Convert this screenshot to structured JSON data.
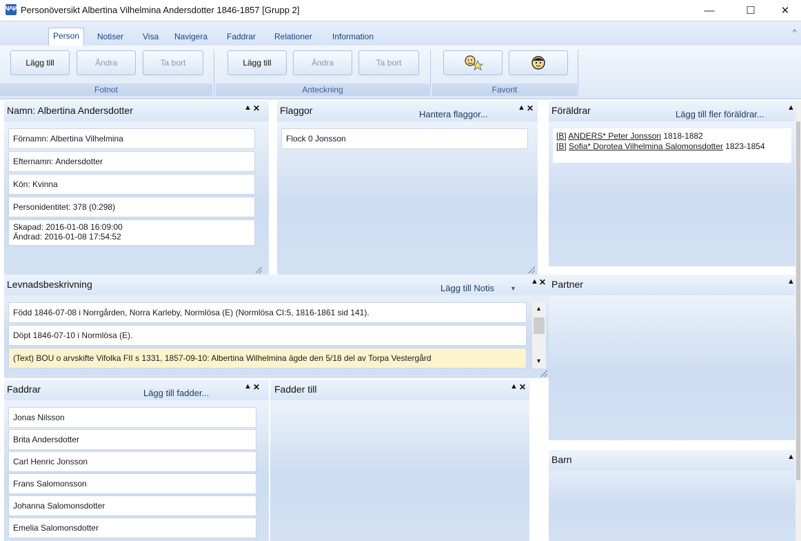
{
  "window": {
    "title": "Personöversikt Albertina Vilhelmina Andersdotter 1846-1857 [Grupp 2]",
    "app_icon": "app-tree-icon",
    "minimize": "—",
    "maximize": "☐",
    "close": "✕"
  },
  "ribbon": {
    "tabs": [
      "Person",
      "Notiser",
      "Visa",
      "Navigera",
      "Faddrar",
      "Relationer",
      "Information"
    ],
    "active_tab": "Person",
    "groups": [
      {
        "label": "Fotnot",
        "buttons": [
          "Lägg till",
          "Ändra",
          "Ta bort"
        ]
      },
      {
        "label": "Anteckning",
        "buttons": [
          "Lägg till",
          "Ändra",
          "Ta bort"
        ]
      },
      {
        "label": "Favorit",
        "buttons": [
          "star-person-icon",
          "face-icon"
        ]
      }
    ],
    "collapse_glyph": "^"
  },
  "panels": {
    "namn": {
      "title": "Namn: Albertina Andersdotter",
      "fields": [
        "Förnamn: Albertina Vilhelmina",
        "Efternamn: Andersdotter",
        "Kön: Kvinna",
        "Personidentitet: 378 (0:298)"
      ],
      "created": "Skapad: 2016-01-08 16:09:00",
      "changed": "Ändrad: 2016-01-08 17:54:52"
    },
    "flaggor": {
      "title": "Flaggor",
      "link": "Hantera flaggor...",
      "items": [
        "Flock 0 Jonsson"
      ]
    },
    "foraldrar": {
      "title": "Föräldrar",
      "link": "Lägg till fler föräldrar...",
      "parents": [
        {
          "tag": "[B]",
          "name": "ANDERS* Peter Jonsson",
          "years": "1818-1882"
        },
        {
          "tag": "[B]",
          "name": "Sofia* Dorotea Vilhelmina Salomonsdotter",
          "years": "1823-1854"
        }
      ]
    },
    "levnad": {
      "title": "Levnadsbeskrivning",
      "link": "Lägg till Notis",
      "items": [
        "Född 1846-07-08 i Norrgården, Norra Karleby, Normlösa (E) (Normlösa CI:5, 1816-1861 sid  141).",
        "Döpt 1846-07-10 i Normlösa (E).",
        "(Text) BOU o arvskifte  Vifolka FII s 1331, 1857-09-10:  Albertina Wilhelmina ägde den  5/18 del av Torpa Vestergård"
      ]
    },
    "partner": {
      "title": "Partner"
    },
    "faddrar": {
      "title": "Faddrar",
      "link": "Lägg till fadder...",
      "items": [
        "Jonas Nilsson",
        "Brita Andersdotter",
        "Carl Henric Jonsson",
        "Frans Salomonsson",
        "Johanna Salomonsdotter",
        "Emelia Salomonsdotter"
      ]
    },
    "fadder_till": {
      "title": "Fadder till"
    },
    "barn": {
      "title": "Barn"
    }
  },
  "glyphs": {
    "pin": "▲",
    "close": "✕",
    "dropdown": "▼",
    "up": "▲",
    "down": "▼"
  },
  "colors": {
    "ribbon_text": "#15428b",
    "panel_bg": "#d3e1f3",
    "selected_item": "#fdf3cd"
  }
}
